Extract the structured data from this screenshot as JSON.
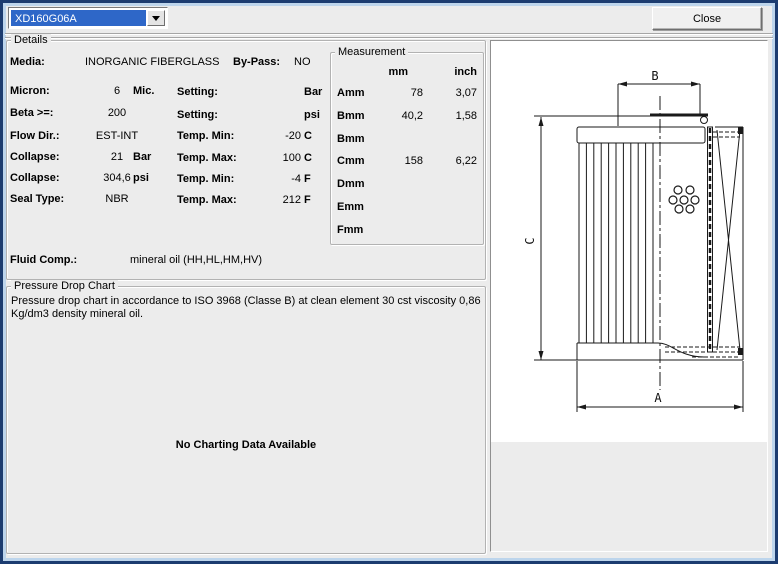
{
  "toolbar": {
    "combo_value": "XD160G06A",
    "close_label": "Close"
  },
  "details": {
    "caption": "Details",
    "media_label": "Media:",
    "media_value": "INORGANIC FIBERGLASS",
    "bypass_label": "By-Pass:",
    "bypass_value": "NO",
    "rows_left": [
      {
        "label": "Micron:",
        "value": "6",
        "unit": "Mic."
      },
      {
        "label": "Beta >=:",
        "value": "200",
        "unit": ""
      },
      {
        "label": "Flow Dir.:",
        "value": "EST-INT",
        "unit": ""
      },
      {
        "label": "Collapse:",
        "value": "21",
        "unit": "Bar"
      },
      {
        "label": "Collapse:",
        "value": "304,6",
        "unit": "psi"
      },
      {
        "label": "Seal Type:",
        "value": "NBR",
        "unit": ""
      }
    ],
    "rows_right": [
      {
        "label": "Setting:",
        "value": "",
        "unit": "Bar"
      },
      {
        "label": "Setting:",
        "value": "",
        "unit": "psi"
      },
      {
        "label": "Temp. Min:",
        "value": "-20",
        "unit": "C"
      },
      {
        "label": "Temp. Max:",
        "value": "100",
        "unit": "C"
      },
      {
        "label": "Temp. Min:",
        "value": "-4",
        "unit": "F"
      },
      {
        "label": "Temp. Max:",
        "value": "212",
        "unit": "F"
      }
    ],
    "fluid_label": "Fluid Comp.:",
    "fluid_value": "mineral oil (HH,HL,HM,HV)"
  },
  "measurement": {
    "caption": "Measurement",
    "col_mm": "mm",
    "col_inch": "inch",
    "rows": [
      {
        "label": "Amm",
        "mm": "78",
        "inch": "3,07"
      },
      {
        "label": "Bmm",
        "mm": "40,2",
        "inch": "1,58"
      },
      {
        "label": "Bmm",
        "mm": "",
        "inch": ""
      },
      {
        "label": "Cmm",
        "mm": "158",
        "inch": "6,22"
      },
      {
        "label": "Dmm",
        "mm": "",
        "inch": ""
      },
      {
        "label": "Emm",
        "mm": "",
        "inch": ""
      },
      {
        "label": "Fmm",
        "mm": "",
        "inch": ""
      }
    ]
  },
  "pressure_chart": {
    "caption": "Pressure Drop Chart",
    "description": "Pressure drop chart in accordance to ISO 3968 (Classe B) at clean element 30 cst viscosity 0,86 Kg/dm3 density mineral oil.",
    "no_data": "No Charting Data Available"
  },
  "diagram": {
    "dim_a": "A",
    "dim_b": "B",
    "dim_c": "C"
  },
  "colors": {
    "selection_blue": "#2e67c8",
    "frame_navy": "#1c3c70",
    "frame_light_blue": "#bdd5ec",
    "background": "#ececec"
  }
}
